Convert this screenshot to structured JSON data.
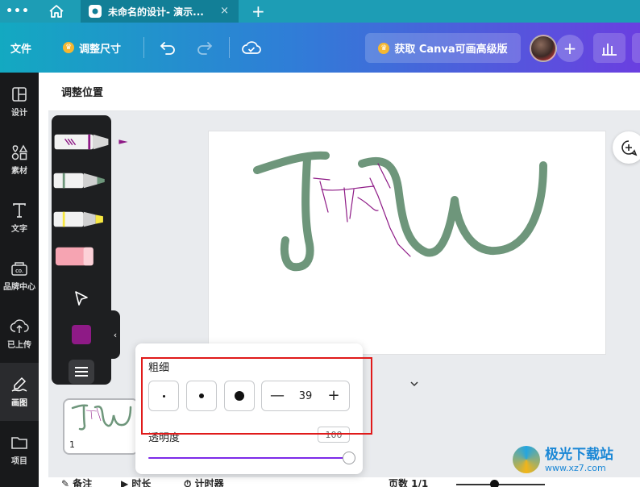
{
  "tabbar": {
    "dots": "•••",
    "tab_title": "未命名的设计- 演示...",
    "close": "×",
    "new_tab": "+"
  },
  "header": {
    "file": "文件",
    "resize": "调整尺寸",
    "upgrade": "获取 Canva可画高级版",
    "invite": "+"
  },
  "sidebar": {
    "items": [
      {
        "label": "设计",
        "icon": "layout-icon"
      },
      {
        "label": "素材",
        "icon": "elements-icon"
      },
      {
        "label": "文字",
        "icon": "text-icon"
      },
      {
        "label": "品牌中心",
        "icon": "brand-icon"
      },
      {
        "label": "已上传",
        "icon": "upload-icon"
      },
      {
        "label": "画图",
        "icon": "draw-icon"
      },
      {
        "label": "项目",
        "icon": "folder-icon"
      }
    ],
    "active": "画图"
  },
  "context_bar": {
    "title": "调整位置"
  },
  "palette": {
    "tools": [
      "marker-pen",
      "green-pen",
      "yellow-highlighter",
      "pink-eraser",
      "select-arrow"
    ],
    "selected_color": "#8e1a86"
  },
  "drawing_colors": {
    "green": "#6e967b",
    "purple": "#8e1a86"
  },
  "popup": {
    "thickness_label": "粗细",
    "thickness_value": "39",
    "opacity_label": "透明度",
    "opacity_value": "100",
    "decrement": "—",
    "increment": "+"
  },
  "pages": {
    "thumb_number": "1"
  },
  "footer": {
    "notes": "备注",
    "duration": "时长",
    "timer": "计时器",
    "page_count": "页数 1/1"
  },
  "watermark": {
    "title": "极光下载站",
    "url": "www.xz7.com"
  }
}
